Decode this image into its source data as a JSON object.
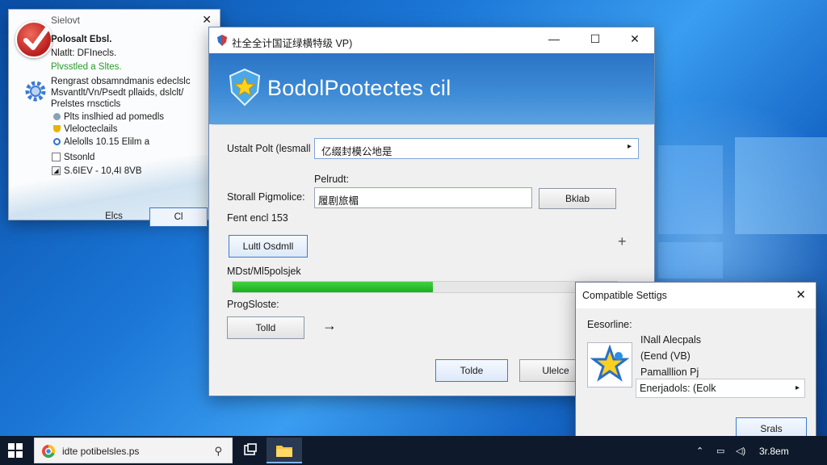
{
  "left_window": {
    "title": "Sielovt",
    "lines": [
      "Polosalt Ebsl.",
      "Nlatlt: DFInecls.",
      "Plvsstled a Sltes.",
      "Rengrast obsamndmanis edeclslc",
      "Msvantlt/Vn/Psedt pllaids, dslclt/",
      "Prelstes rnscticls",
      "Plts inslhied ad pomedls",
      "Vlelocteclails",
      "Alelolls 10.15 Elilm a",
      "Stsonld",
      "S.6IEV - 10,4I 8VB"
    ],
    "btn_left": "Elcs",
    "btn_right": "Cl"
  },
  "main_window": {
    "title": "社全全计国证绿横特级 VP)",
    "brand": "BodolPootectes cil",
    "install_label": "Ustalt Polt (lesmall",
    "install_value": "亿缀封模公地是",
    "path_label": "Pelrudt:",
    "storage_label": "Storall Pigmolice:",
    "storage_value": "履剧旅楣",
    "browse_button": "Bklab",
    "free_space": "Fent encl 153",
    "options_button": "Lultl Osdmll",
    "plus": "+",
    "status_label": "MDst/Ml5polsjek",
    "progress": 0.52,
    "progress_label": "ProgSloste:",
    "tools_button": "Tolld",
    "arrow": "→",
    "ok_button": "Tolde",
    "cancel_button": "Ulelce"
  },
  "compat_dialog": {
    "title": "Compatible Settigs",
    "section": "Eesorline:",
    "lines": [
      "INall Alecpals",
      "(Eend (VB)",
      "Pamalllion Pj"
    ],
    "field_value": "Enerjadols: (Eolk",
    "button": "Srals"
  },
  "taskbar": {
    "search_text": "idte potibelsles.ps",
    "clock": "3r.8em"
  },
  "colors": {
    "accent": "#2b74c6",
    "progress": "#22b822",
    "taskbar": "#0e1a2b"
  }
}
